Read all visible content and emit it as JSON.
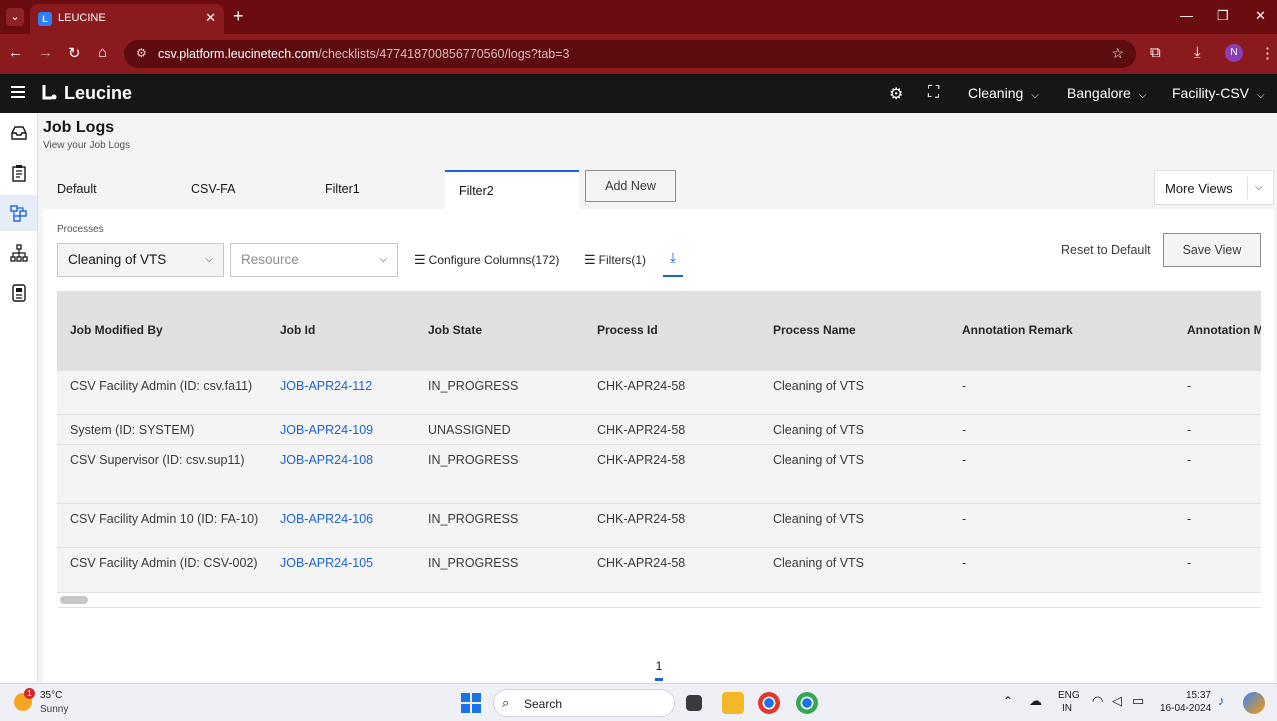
{
  "browser": {
    "tab_title": "LEUCINE",
    "url_host": "csv.platform.leucinetech.com",
    "url_path": "/checklists/477418700856770560/logs?tab=3",
    "profile_initial": "N"
  },
  "app": {
    "brand": "Leucine",
    "header": {
      "usecase": "Cleaning",
      "location": "Bangalore",
      "facility": "Facility-CSV"
    }
  },
  "page": {
    "title": "Job Logs",
    "subtitle": "View your Job Logs"
  },
  "views": {
    "tabs": [
      "Default",
      "CSV-FA",
      "Filter1",
      "Filter2"
    ],
    "active": "Filter2",
    "add_new": "Add New",
    "more_views": "More Views"
  },
  "toolbar": {
    "processes_label": "Processes",
    "process_value": "Cleaning of VTS",
    "resource_placeholder": "Resource",
    "configure_columns": "Configure Columns(172)",
    "filters": "Filters(1)",
    "reset": "Reset to Default",
    "save_view": "Save View"
  },
  "table": {
    "columns": [
      "Job Modified By",
      "Job Id",
      "Job State",
      "Process Id",
      "Process Name",
      "Annotation Remark",
      "Annotation M"
    ],
    "rows": [
      [
        "CSV Facility Admin (ID: csv.fa11)",
        "JOB-APR24-112",
        "IN_PROGRESS",
        "CHK-APR24-58",
        "Cleaning of VTS",
        "-",
        "-"
      ],
      [
        "System (ID: SYSTEM)",
        "JOB-APR24-109",
        "UNASSIGNED",
        "CHK-APR24-58",
        "Cleaning of VTS",
        "-",
        "-"
      ],
      [
        "CSV Supervisor (ID: csv.sup11)",
        "JOB-APR24-108",
        "IN_PROGRESS",
        "CHK-APR24-58",
        "Cleaning of VTS",
        "-",
        "-"
      ],
      [
        "CSV Facility Admin 10 (ID: FA-10)",
        "JOB-APR24-106",
        "IN_PROGRESS",
        "CHK-APR24-58",
        "Cleaning of VTS",
        "-",
        "-"
      ],
      [
        "CSV Facility Admin (ID: CSV-002)",
        "JOB-APR24-105",
        "IN_PROGRESS",
        "CHK-APR24-58",
        "Cleaning of VTS",
        "-",
        "-"
      ]
    ]
  },
  "pagination": {
    "current": "1"
  },
  "taskbar": {
    "weather_badge": "1",
    "temperature": "35°C",
    "weather": "Sunny",
    "search": "Search",
    "lang_1": "ENG",
    "lang_2": "IN",
    "time": "15:37",
    "date": "16-04-2024"
  },
  "colors": {
    "accent": "#1d62d3",
    "browser_frame": "#8b1a1e",
    "app_header": "#161616"
  }
}
